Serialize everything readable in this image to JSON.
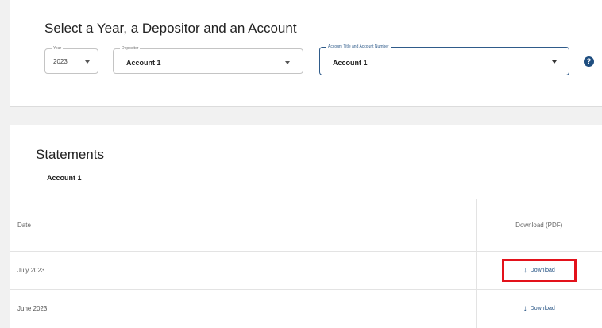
{
  "selection": {
    "title": "Select a Year, a Depositor and an Account",
    "year": {
      "label": "Year",
      "value": "2023"
    },
    "depositor": {
      "label": "Depositor",
      "value": "Account 1"
    },
    "account": {
      "label": "Account Title and Account Number",
      "value": "Account 1"
    },
    "help_icon": "?"
  },
  "statements": {
    "title": "Statements",
    "account_name": "Account 1",
    "columns": {
      "date": "Date",
      "download": "Download (PDF)"
    },
    "rows": [
      {
        "date": "July 2023",
        "download_label": "Download",
        "highlighted": true
      },
      {
        "date": "June 2023",
        "download_label": "Download",
        "highlighted": false
      }
    ]
  },
  "colors": {
    "accent": "#1f4e80",
    "highlight": "#e3121b"
  },
  "icons": {
    "download": "download-arrow-icon",
    "help": "question-circle-icon",
    "dropdown": "caret-down-icon"
  }
}
